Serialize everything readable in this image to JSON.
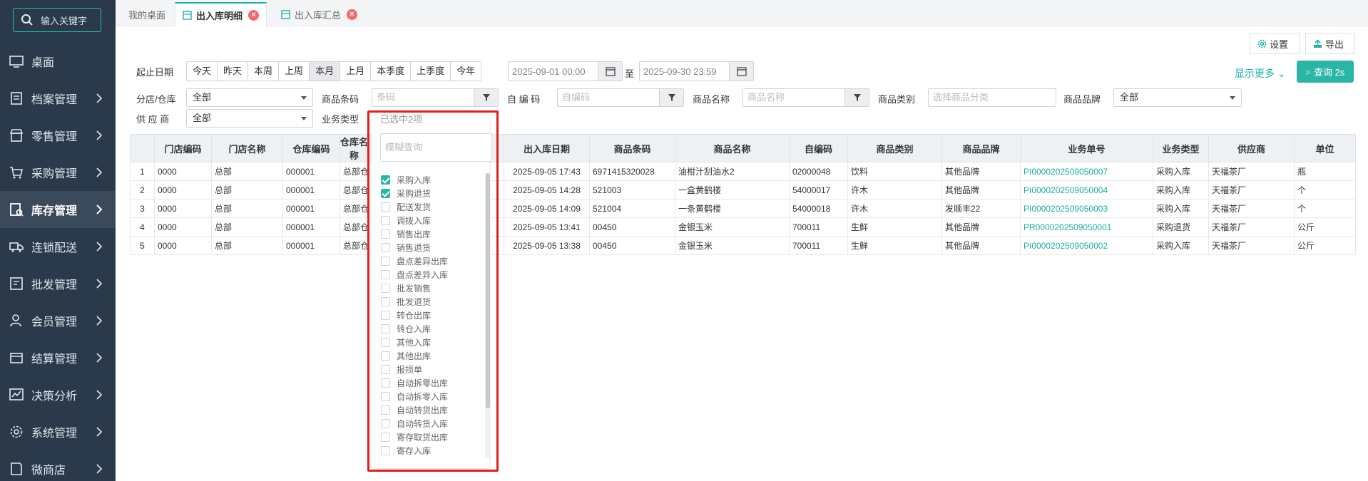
{
  "sidebar": {
    "search_placeholder": "输入关键字",
    "items": [
      {
        "label": "桌面"
      },
      {
        "label": "档案管理"
      },
      {
        "label": "零售管理"
      },
      {
        "label": "采购管理"
      },
      {
        "label": "库存管理"
      },
      {
        "label": "连锁配送"
      },
      {
        "label": "批发管理"
      },
      {
        "label": "会员管理"
      },
      {
        "label": "结算管理"
      },
      {
        "label": "决策分析"
      },
      {
        "label": "系统管理"
      },
      {
        "label": "微商店"
      }
    ],
    "active_item": "库存管理"
  },
  "tabs": [
    {
      "label": "我的桌面"
    },
    {
      "label": "出入库明细"
    },
    {
      "label": "出入库汇总"
    }
  ],
  "toolbar": {
    "settings_label": "设置",
    "export_label": "导出"
  },
  "filters": {
    "date_label": "起止日期",
    "date_presets": [
      "今天",
      "昨天",
      "本周",
      "上周",
      "本月",
      "上月",
      "本季度",
      "上季度",
      "今年"
    ],
    "active_preset": "本月",
    "start_date": "2025-09-01 00:00",
    "to_label": "至",
    "end_date": "2025-09-30 23:59",
    "show_more": "显示更多",
    "query_button": "查询 2s",
    "store_label": "分店/仓库",
    "store_value": "全部",
    "barcode_label": "商品条码",
    "barcode_placeholder": "条码",
    "selfcode_label": "自 编 码",
    "selfcode_placeholder": "自编码",
    "name_label": "商品名称",
    "name_placeholder": "商品名称",
    "category_label": "商品类别",
    "category_placeholder": "选择商品分类",
    "brand_label": "商品品牌",
    "brand_value": "全部",
    "supplier_label": "供 应 商",
    "supplier_value": "全部",
    "biztype_label": "业务类型"
  },
  "table": {
    "columns": [
      "",
      "门店编码",
      "门店名称",
      "仓库编码",
      "仓库名称",
      "",
      "出入库日期",
      "商品条码",
      "商品名称",
      "自编码",
      "商品类别",
      "商品品牌",
      "业务单号",
      "业务类型",
      "供应商",
      "单位"
    ],
    "rows": [
      [
        "1",
        "0000",
        "总部",
        "000001",
        "总部仓库",
        "",
        "2025-09-05 17:43",
        "6971415320028",
        "油柑汁刮油水2",
        "02000048",
        "饮料",
        "其他品牌",
        "PI0000202509050007",
        "采购入库",
        "天福茶厂",
        "瓶"
      ],
      [
        "2",
        "0000",
        "总部",
        "000001",
        "总部仓库",
        "",
        "2025-09-05 14:28",
        "521003",
        "一盒黄鹤楼",
        "54000017",
        "许木",
        "其他品牌",
        "PI0000202509050004",
        "采购入库",
        "天福茶厂",
        "个"
      ],
      [
        "3",
        "0000",
        "总部",
        "000001",
        "总部仓库",
        "",
        "2025-09-05 14:09",
        "521004",
        "一条黄鹤楼",
        "54000018",
        "许木",
        "发顺丰22",
        "PI0000202509050003",
        "采购入库",
        "天福茶厂",
        "个"
      ],
      [
        "4",
        "0000",
        "总部",
        "000001",
        "总部仓库",
        "",
        "2025-09-05 13:41",
        "00450",
        "金银玉米",
        "700011",
        "生鲜",
        "其他品牌",
        "PR0000202509050001",
        "采购退货",
        "天福茶厂",
        "公斤"
      ],
      [
        "5",
        "0000",
        "总部",
        "000001",
        "总部仓库",
        "",
        "2025-09-05 13:38",
        "00450",
        "金银玉米",
        "700011",
        "生鲜",
        "其他品牌",
        "PI0000202509050002",
        "采购入库",
        "天福茶厂",
        "公斤"
      ]
    ]
  },
  "biztype_dropdown": {
    "selected_summary": "已选中2项",
    "search_placeholder": "模糊查询",
    "options": [
      {
        "label": "采购入库",
        "checked": true
      },
      {
        "label": "采购退货",
        "checked": true
      },
      {
        "label": "配送发货",
        "checked": false
      },
      {
        "label": "调拨入库",
        "checked": false
      },
      {
        "label": "销售出库",
        "checked": false
      },
      {
        "label": "销售退货",
        "checked": false
      },
      {
        "label": "盘点差异出库",
        "checked": false
      },
      {
        "label": "盘点差异入库",
        "checked": false
      },
      {
        "label": "批发销售",
        "checked": false
      },
      {
        "label": "批发退货",
        "checked": false
      },
      {
        "label": "转仓出库",
        "checked": false
      },
      {
        "label": "转仓入库",
        "checked": false
      },
      {
        "label": "其他入库",
        "checked": false
      },
      {
        "label": "其他出库",
        "checked": false
      },
      {
        "label": "报损单",
        "checked": false
      },
      {
        "label": "自动拆零出库",
        "checked": false
      },
      {
        "label": "自动拆零入库",
        "checked": false
      },
      {
        "label": "自动转货出库",
        "checked": false
      },
      {
        "label": "自动转货入库",
        "checked": false
      },
      {
        "label": "寄存取货出库",
        "checked": false
      },
      {
        "label": "寄存入库",
        "checked": false
      }
    ]
  },
  "colors": {
    "accent": "#2ab6a6",
    "sidebar": "#2b3a4a",
    "highlight": "#e0201e"
  }
}
